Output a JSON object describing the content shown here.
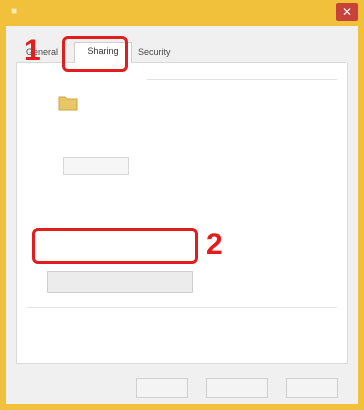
{
  "window": {
    "title": "",
    "close_glyph": "✕"
  },
  "tabs": [
    {
      "label": "General"
    },
    {
      "label": "Sharing"
    },
    {
      "label": "Security"
    }
  ],
  "network_sharing": {
    "heading": "",
    "folder_name": "",
    "folder_sub": "",
    "path_label": "",
    "path_value": "",
    "share_button": ""
  },
  "advanced_sharing": {
    "heading": "",
    "description": "",
    "button": ""
  },
  "password_protection": {
    "heading": "",
    "description": "",
    "link_prefix": "",
    "link_text": ""
  },
  "footer": {
    "ok": "",
    "cancel": "",
    "apply": ""
  },
  "annotations": {
    "marker1": "1",
    "marker2": "2",
    "marker_color": "#e31d1d"
  }
}
